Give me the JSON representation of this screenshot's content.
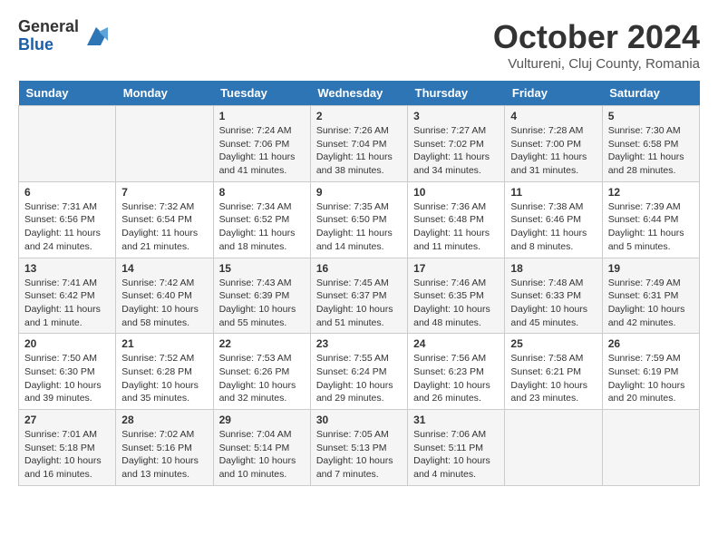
{
  "header": {
    "logo_general": "General",
    "logo_blue": "Blue",
    "month": "October 2024",
    "location": "Vultureni, Cluj County, Romania"
  },
  "weekdays": [
    "Sunday",
    "Monday",
    "Tuesday",
    "Wednesday",
    "Thursday",
    "Friday",
    "Saturday"
  ],
  "weeks": [
    [
      {
        "day": "",
        "info": ""
      },
      {
        "day": "",
        "info": ""
      },
      {
        "day": "1",
        "info": "Sunrise: 7:24 AM\nSunset: 7:06 PM\nDaylight: 11 hours and 41 minutes."
      },
      {
        "day": "2",
        "info": "Sunrise: 7:26 AM\nSunset: 7:04 PM\nDaylight: 11 hours and 38 minutes."
      },
      {
        "day": "3",
        "info": "Sunrise: 7:27 AM\nSunset: 7:02 PM\nDaylight: 11 hours and 34 minutes."
      },
      {
        "day": "4",
        "info": "Sunrise: 7:28 AM\nSunset: 7:00 PM\nDaylight: 11 hours and 31 minutes."
      },
      {
        "day": "5",
        "info": "Sunrise: 7:30 AM\nSunset: 6:58 PM\nDaylight: 11 hours and 28 minutes."
      }
    ],
    [
      {
        "day": "6",
        "info": "Sunrise: 7:31 AM\nSunset: 6:56 PM\nDaylight: 11 hours and 24 minutes."
      },
      {
        "day": "7",
        "info": "Sunrise: 7:32 AM\nSunset: 6:54 PM\nDaylight: 11 hours and 21 minutes."
      },
      {
        "day": "8",
        "info": "Sunrise: 7:34 AM\nSunset: 6:52 PM\nDaylight: 11 hours and 18 minutes."
      },
      {
        "day": "9",
        "info": "Sunrise: 7:35 AM\nSunset: 6:50 PM\nDaylight: 11 hours and 14 minutes."
      },
      {
        "day": "10",
        "info": "Sunrise: 7:36 AM\nSunset: 6:48 PM\nDaylight: 11 hours and 11 minutes."
      },
      {
        "day": "11",
        "info": "Sunrise: 7:38 AM\nSunset: 6:46 PM\nDaylight: 11 hours and 8 minutes."
      },
      {
        "day": "12",
        "info": "Sunrise: 7:39 AM\nSunset: 6:44 PM\nDaylight: 11 hours and 5 minutes."
      }
    ],
    [
      {
        "day": "13",
        "info": "Sunrise: 7:41 AM\nSunset: 6:42 PM\nDaylight: 11 hours and 1 minute."
      },
      {
        "day": "14",
        "info": "Sunrise: 7:42 AM\nSunset: 6:40 PM\nDaylight: 10 hours and 58 minutes."
      },
      {
        "day": "15",
        "info": "Sunrise: 7:43 AM\nSunset: 6:39 PM\nDaylight: 10 hours and 55 minutes."
      },
      {
        "day": "16",
        "info": "Sunrise: 7:45 AM\nSunset: 6:37 PM\nDaylight: 10 hours and 51 minutes."
      },
      {
        "day": "17",
        "info": "Sunrise: 7:46 AM\nSunset: 6:35 PM\nDaylight: 10 hours and 48 minutes."
      },
      {
        "day": "18",
        "info": "Sunrise: 7:48 AM\nSunset: 6:33 PM\nDaylight: 10 hours and 45 minutes."
      },
      {
        "day": "19",
        "info": "Sunrise: 7:49 AM\nSunset: 6:31 PM\nDaylight: 10 hours and 42 minutes."
      }
    ],
    [
      {
        "day": "20",
        "info": "Sunrise: 7:50 AM\nSunset: 6:30 PM\nDaylight: 10 hours and 39 minutes."
      },
      {
        "day": "21",
        "info": "Sunrise: 7:52 AM\nSunset: 6:28 PM\nDaylight: 10 hours and 35 minutes."
      },
      {
        "day": "22",
        "info": "Sunrise: 7:53 AM\nSunset: 6:26 PM\nDaylight: 10 hours and 32 minutes."
      },
      {
        "day": "23",
        "info": "Sunrise: 7:55 AM\nSunset: 6:24 PM\nDaylight: 10 hours and 29 minutes."
      },
      {
        "day": "24",
        "info": "Sunrise: 7:56 AM\nSunset: 6:23 PM\nDaylight: 10 hours and 26 minutes."
      },
      {
        "day": "25",
        "info": "Sunrise: 7:58 AM\nSunset: 6:21 PM\nDaylight: 10 hours and 23 minutes."
      },
      {
        "day": "26",
        "info": "Sunrise: 7:59 AM\nSunset: 6:19 PM\nDaylight: 10 hours and 20 minutes."
      }
    ],
    [
      {
        "day": "27",
        "info": "Sunrise: 7:01 AM\nSunset: 5:18 PM\nDaylight: 10 hours and 16 minutes."
      },
      {
        "day": "28",
        "info": "Sunrise: 7:02 AM\nSunset: 5:16 PM\nDaylight: 10 hours and 13 minutes."
      },
      {
        "day": "29",
        "info": "Sunrise: 7:04 AM\nSunset: 5:14 PM\nDaylight: 10 hours and 10 minutes."
      },
      {
        "day": "30",
        "info": "Sunrise: 7:05 AM\nSunset: 5:13 PM\nDaylight: 10 hours and 7 minutes."
      },
      {
        "day": "31",
        "info": "Sunrise: 7:06 AM\nSunset: 5:11 PM\nDaylight: 10 hours and 4 minutes."
      },
      {
        "day": "",
        "info": ""
      },
      {
        "day": "",
        "info": ""
      }
    ]
  ]
}
